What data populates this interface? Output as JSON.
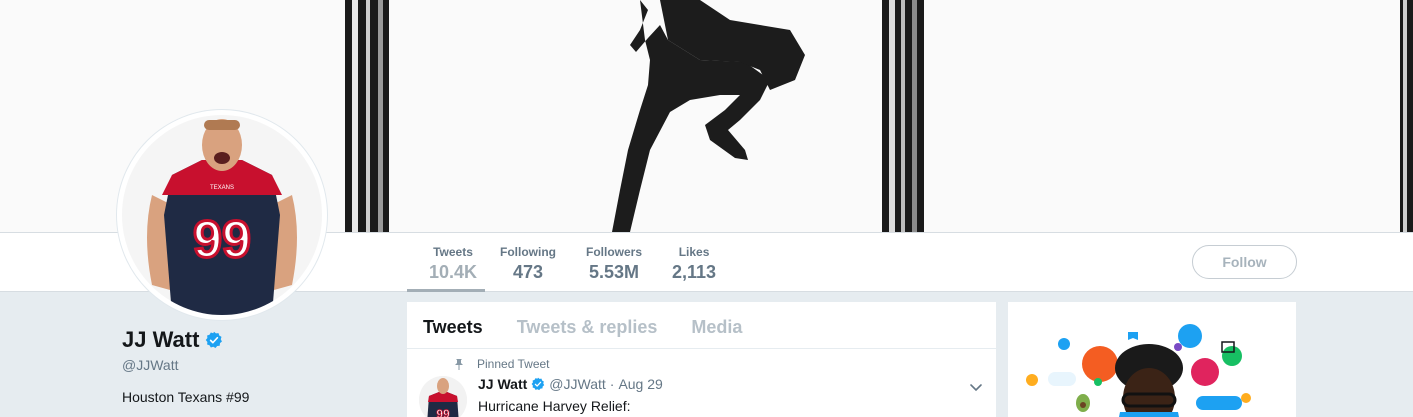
{
  "profile": {
    "name": "JJ Watt",
    "handle": "@JJWatt",
    "bio": "Houston Texans #99",
    "verified_icon": "verified-badge-icon",
    "accent_color": "#1da1f2"
  },
  "nav": {
    "stats": [
      {
        "label": "Tweets",
        "value": "10.4K",
        "active": true
      },
      {
        "label": "Following",
        "value": "473"
      },
      {
        "label": "Followers",
        "value": "5.53M"
      },
      {
        "label": "Likes",
        "value": "2,113"
      }
    ],
    "follow_label": "Follow"
  },
  "timeline": {
    "tabs": [
      {
        "label": "Tweets",
        "active": true
      },
      {
        "label": "Tweets & replies"
      },
      {
        "label": "Media"
      }
    ],
    "pinned_label": "Pinned Tweet",
    "tweet": {
      "name": "JJ Watt",
      "handle": "@JJWatt",
      "separator": "·",
      "date": "Aug 29",
      "text": "Hurricane Harvey Relief:"
    }
  },
  "avatar": {
    "jersey_number": "99",
    "team_label": "TEXANS"
  },
  "tweet_avatar": {
    "jersey_number": "99"
  }
}
